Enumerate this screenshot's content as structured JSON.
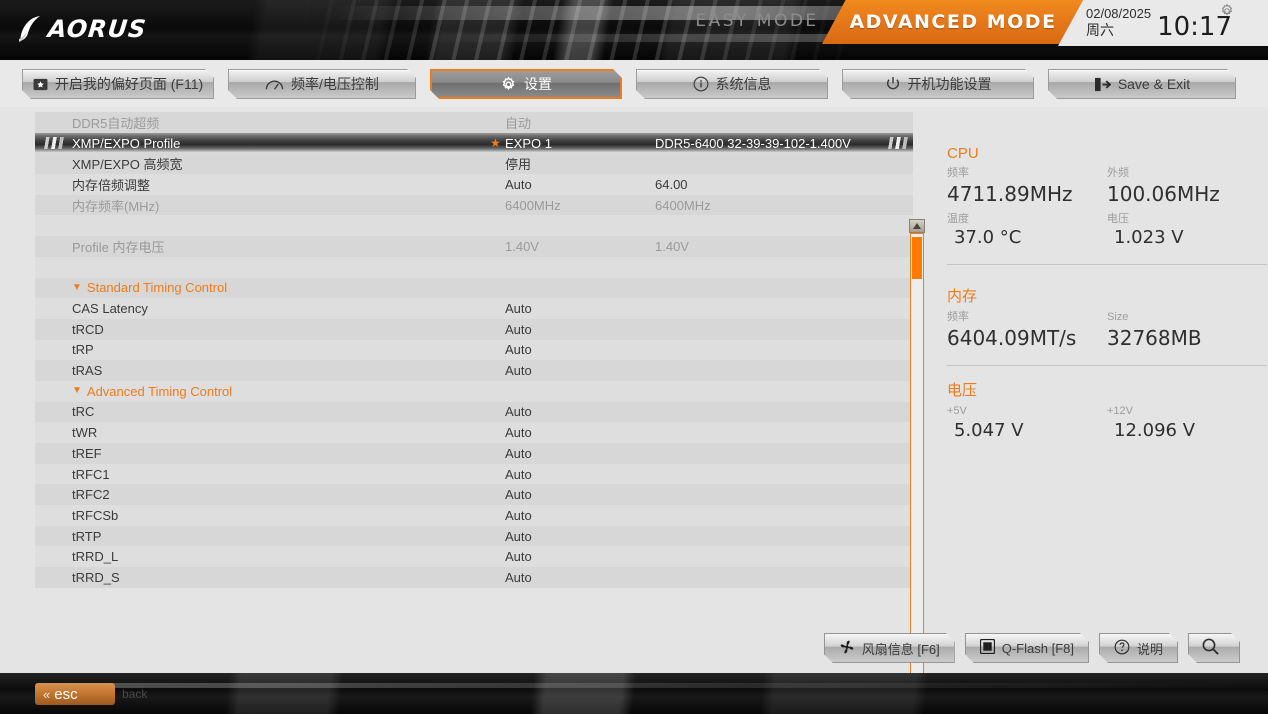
{
  "header": {
    "brand": "AORUS",
    "easy_mode": "EASY MODE",
    "advanced_mode": "ADVANCED MODE",
    "date": "02/08/2025",
    "weekday": "周六",
    "time": "10:17",
    "gear_icon": "gear-icon",
    "accent_color": "#ef7c1b"
  },
  "nav": {
    "tabs": [
      {
        "label": "开启我的偏好页面 (F11)",
        "icon": "favorite-page-icon",
        "active": false
      },
      {
        "label": "频率/电压控制",
        "icon": "gauge-icon",
        "active": false
      },
      {
        "label": "设置",
        "icon": "gear-icon",
        "active": true
      },
      {
        "label": "系统信息",
        "icon": "info-icon",
        "active": false
      },
      {
        "label": "开机功能设置",
        "icon": "power-icon",
        "active": false
      },
      {
        "label": "Save & Exit",
        "icon": "exit-icon",
        "active": false
      }
    ]
  },
  "settings_rows": [
    {
      "label": "DDR5自动超频",
      "value": "自动",
      "value2": "",
      "dim": true,
      "selected": false,
      "section": false,
      "star": false
    },
    {
      "label": "XMP/EXPO Profile",
      "value": "EXPO 1",
      "value2": "DDR5-6400 32-39-39-102-1.400V",
      "dim": false,
      "selected": true,
      "section": false,
      "star": true
    },
    {
      "label": "XMP/EXPO 高频宽",
      "value": "停用",
      "value2": "",
      "dim": false,
      "selected": false,
      "section": false,
      "star": false
    },
    {
      "label": "内存倍频调整",
      "value": "Auto",
      "value2": "64.00",
      "dim": false,
      "selected": false,
      "section": false,
      "star": false
    },
    {
      "label": "内存频率(MHz)",
      "value": "6400MHz",
      "value2": "6400MHz",
      "dim": true,
      "selected": false,
      "section": false,
      "star": false
    },
    {
      "label": "",
      "value": "",
      "value2": "",
      "dim": false,
      "selected": false,
      "section": false,
      "star": false
    },
    {
      "label": "Profile 内存电压",
      "value": "1.40V",
      "value2": "1.40V",
      "dim": true,
      "selected": false,
      "section": false,
      "star": false
    },
    {
      "label": "",
      "value": "",
      "value2": "",
      "dim": false,
      "selected": false,
      "section": false,
      "star": false
    },
    {
      "label": "Standard Timing Control",
      "value": "",
      "value2": "",
      "dim": false,
      "selected": false,
      "section": true,
      "star": false
    },
    {
      "label": "CAS Latency",
      "value": "Auto",
      "value2": "",
      "dim": false,
      "selected": false,
      "section": false,
      "star": false
    },
    {
      "label": "tRCD",
      "value": "Auto",
      "value2": "",
      "dim": false,
      "selected": false,
      "section": false,
      "star": false
    },
    {
      "label": "tRP",
      "value": "Auto",
      "value2": "",
      "dim": false,
      "selected": false,
      "section": false,
      "star": false
    },
    {
      "label": "tRAS",
      "value": "Auto",
      "value2": "",
      "dim": false,
      "selected": false,
      "section": false,
      "star": false
    },
    {
      "label": "Advanced Timing Control",
      "value": "",
      "value2": "",
      "dim": false,
      "selected": false,
      "section": true,
      "star": false
    },
    {
      "label": "tRC",
      "value": "Auto",
      "value2": "",
      "dim": false,
      "selected": false,
      "section": false,
      "star": false
    },
    {
      "label": "tWR",
      "value": "Auto",
      "value2": "",
      "dim": false,
      "selected": false,
      "section": false,
      "star": false
    },
    {
      "label": "tREF",
      "value": "Auto",
      "value2": "",
      "dim": false,
      "selected": false,
      "section": false,
      "star": false
    },
    {
      "label": "tRFC1",
      "value": "Auto",
      "value2": "",
      "dim": false,
      "selected": false,
      "section": false,
      "star": false
    },
    {
      "label": "tRFC2",
      "value": "Auto",
      "value2": "",
      "dim": false,
      "selected": false,
      "section": false,
      "star": false
    },
    {
      "label": "tRFCSb",
      "value": "Auto",
      "value2": "",
      "dim": false,
      "selected": false,
      "section": false,
      "star": false
    },
    {
      "label": "tRTP",
      "value": "Auto",
      "value2": "",
      "dim": false,
      "selected": false,
      "section": false,
      "star": false
    },
    {
      "label": "tRRD_L",
      "value": "Auto",
      "value2": "",
      "dim": false,
      "selected": false,
      "section": false,
      "star": false
    },
    {
      "label": "tRRD_S",
      "value": "Auto",
      "value2": "",
      "dim": false,
      "selected": false,
      "section": false,
      "star": false
    }
  ],
  "sidebar": {
    "cpu": {
      "title": "CPU",
      "freq_label": "频率",
      "freq_value": "4711.89MHz",
      "bclk_label": "外频",
      "bclk_value": "100.06MHz",
      "temp_label": "温度",
      "temp_value": "37.0 °C",
      "volt_label": "电压",
      "volt_value": "1.023 V"
    },
    "memory": {
      "title": "内存",
      "freq_label": "频率",
      "freq_value": "6404.09MT/s",
      "size_label": "Size",
      "size_value": "32768MB"
    },
    "voltage": {
      "title": "电压",
      "v5_label": "+5V",
      "v5_value": "5.047 V",
      "v12_label": "+12V",
      "v12_value": "12.096 V"
    }
  },
  "bottom_buttons": [
    {
      "label": "风扇信息 [F6]",
      "icon": "fan-icon"
    },
    {
      "label": "Q-Flash [F8]",
      "icon": "qflash-icon"
    },
    {
      "label": "说明",
      "icon": "help-icon"
    },
    {
      "label": "",
      "icon": "search-icon"
    }
  ],
  "footer": {
    "esc_label": "esc",
    "back_label": "back"
  }
}
